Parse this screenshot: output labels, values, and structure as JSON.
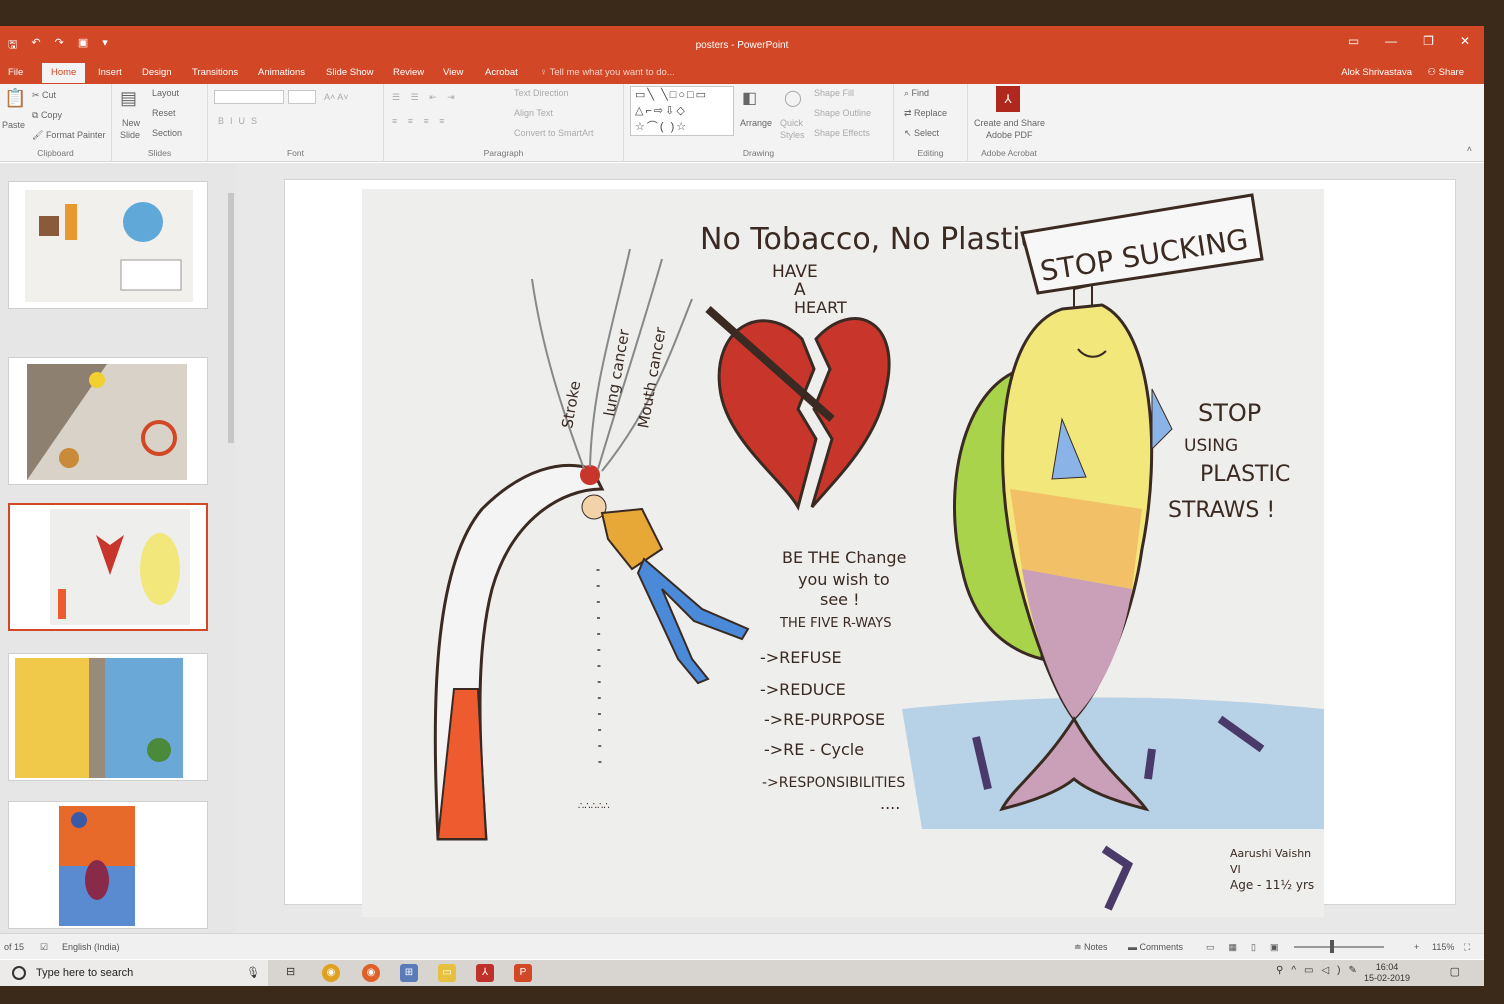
{
  "window": {
    "doc_title": "posters - PowerPoint",
    "min_icon": "minimize-icon",
    "restore_icon": "restore-icon",
    "close_icon": "close-icon"
  },
  "tabs": [
    "File",
    "Home",
    "Insert",
    "Design",
    "Transitions",
    "Animations",
    "Slide Show",
    "Review",
    "View",
    "Acrobat"
  ],
  "active_tab": "Home",
  "tell_me": "Tell me what you want to do...",
  "user": "Alok Shrivastava",
  "share": "Share",
  "ribbon": {
    "clipboard": {
      "paste": "Paste",
      "cut": "Cut",
      "copy": "Copy",
      "format_painter": "Format Painter",
      "label": "Clipboard"
    },
    "slides": {
      "new_slide": "New",
      "new_slide2": "Slide",
      "layout": "Layout",
      "reset": "Reset",
      "section": "Section",
      "label": "Slides"
    },
    "font": {
      "label": "Font"
    },
    "paragraph": {
      "text_direction": "Text Direction",
      "align_text": "Align Text",
      "convert_smartart": "Convert to SmartArt",
      "label": "Paragraph"
    },
    "drawing": {
      "arrange": "Arrange",
      "quick": "Quick",
      "styles": "Styles",
      "shape_fill": "Shape Fill",
      "shape_outline": "Shape Outline",
      "shape_effects": "Shape Effects",
      "label": "Drawing"
    },
    "editing": {
      "find": "Find",
      "replace": "Replace",
      "select": "Select",
      "label": "Editing"
    },
    "acrobat": {
      "create1": "Create and Share",
      "create2": "Adobe PDF",
      "label": "Adobe Acrobat"
    }
  },
  "poster": {
    "title": "No Tobacco, No Plastic",
    "have": "HAVE",
    "a": "A",
    "heart": "HEART",
    "stop_sucking": "STOP SUCKING",
    "smoke_words": [
      "Stroke",
      "lung cancer",
      "Mouth cancer"
    ],
    "stop_using": [
      "STOP",
      "USING",
      "PLASTIC",
      "STRAWS !"
    ],
    "be_change": [
      "BE  THE Change",
      "you wish to",
      "see !",
      "THE FIVE R-WAYS"
    ],
    "r_ways": [
      "->REFUSE",
      "->REDUCE",
      "->RE-PURPOSE",
      "->RE - Cycle",
      "->RESPONSIBILITIES"
    ],
    "dots": "....",
    "signature": [
      "Aarushi Vaishn",
      "VI",
      "Age - 11½ yrs"
    ]
  },
  "status": {
    "slide_of": "of 15",
    "language": "English (India)",
    "notes": "Notes",
    "comments": "Comments",
    "zoom": "115%"
  },
  "taskbar": {
    "search_placeholder": "Type here to search",
    "time": "16:04",
    "date": "15-02-2019"
  },
  "colors": {
    "accent": "#d24726",
    "heart": "#c8362b",
    "cigarette_tip": "#ee5b2f",
    "fish_yellow": "#f2e77a",
    "fish_green": "#a9d34a",
    "fish_mauve": "#c9a0b8",
    "water": "#a9cbe3"
  }
}
